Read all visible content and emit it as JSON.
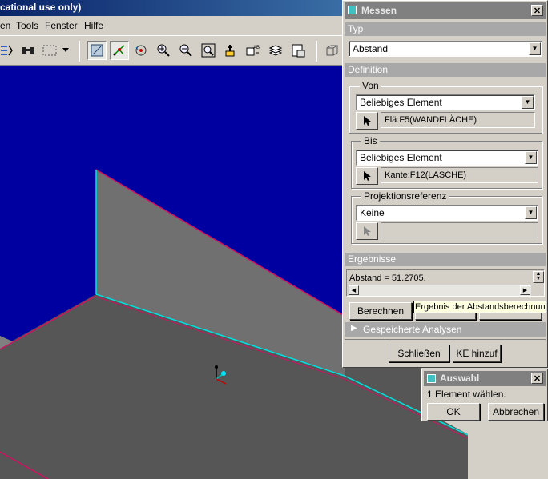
{
  "app": {
    "title": "cational use only)",
    "menu": [
      "en",
      "Tools",
      "Fenster",
      "Hilfe"
    ]
  },
  "toolbar": {
    "icons": [
      "repaint-icon",
      "binoculars-icon",
      "select-box-icon",
      "dropdown-arrow-icon",
      "view-mode-icon",
      "datum-points-icon",
      "spin-center-icon",
      "zoom-in-icon",
      "zoom-out-icon",
      "refit-icon",
      "orient-icon",
      "named-views-icon",
      "layers-icon",
      "model-tree-icon",
      "display-style-icon"
    ]
  },
  "messen": {
    "title": "Messen",
    "typ_label": "Typ",
    "typ_value": "Abstand",
    "definition_label": "Definition",
    "von": {
      "label": "Von",
      "filter": "Beliebiges Element",
      "selection": "Flä:F5(WANDFLÄCHE)"
    },
    "bis": {
      "label": "Bis",
      "filter": "Beliebiges Element",
      "selection": "Kante:F12(LASCHE)"
    },
    "projektion": {
      "label": "Projektionsreferenz",
      "filter": "Keine",
      "selection": ""
    },
    "ergebnisse_label": "Ergebnisse",
    "result": "Abstand = 51.2705.",
    "berechnen": "Berechnen",
    "tooltip": "Ergebnis der Abstandsberechnung",
    "gespeicherte": "Gespeicherte Analysen",
    "schliessen": "Schließen",
    "ke_hinzu": "KE hinzuf"
  },
  "auswahl": {
    "title": "Auswahl",
    "message": "1 Element wählen.",
    "ok": "OK",
    "abbrechen": "Abbrechen"
  },
  "colors": {
    "viewport_bg": "#0000a0",
    "wall": "#707070",
    "floor": "#555555",
    "edge_highlight": "#00e0e0",
    "edge_red": "#d01060"
  }
}
